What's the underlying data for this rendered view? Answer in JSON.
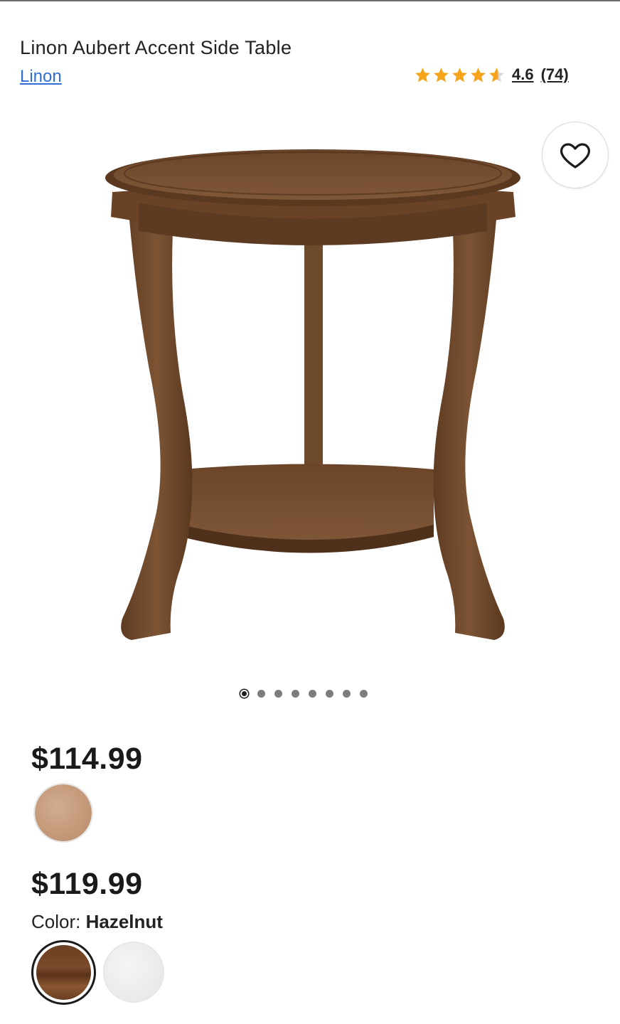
{
  "product": {
    "title": "Linon Aubert Accent Side Table",
    "brand": "Linon",
    "rating": {
      "value": "4.6",
      "count": "(74)",
      "stars_filled": 4.6,
      "star_color": "#f5a31a"
    },
    "image_carousel": {
      "total": 8,
      "active_index": 0
    },
    "prices": [
      {
        "amount": "$114.99",
        "swatches": [
          {
            "icon": "wood-swatch-light",
            "color": "#c49a7a"
          }
        ]
      },
      {
        "amount": "$119.99",
        "swatches": [
          {
            "icon": "wood-swatch-hazelnut",
            "color": "#6b3f22",
            "selected": true
          },
          {
            "icon": "white-swatch",
            "color": "#e9eae9"
          }
        ]
      }
    ],
    "color": {
      "label": "Color:",
      "value": "Hazelnut"
    }
  },
  "icons": {
    "favorite": "heart-icon",
    "rating": "star-icon"
  },
  "colors": {
    "link": "#2f6fd3",
    "text": "#222222",
    "dot": "#7c7c7c",
    "dot_active": "#1d1d1d"
  }
}
